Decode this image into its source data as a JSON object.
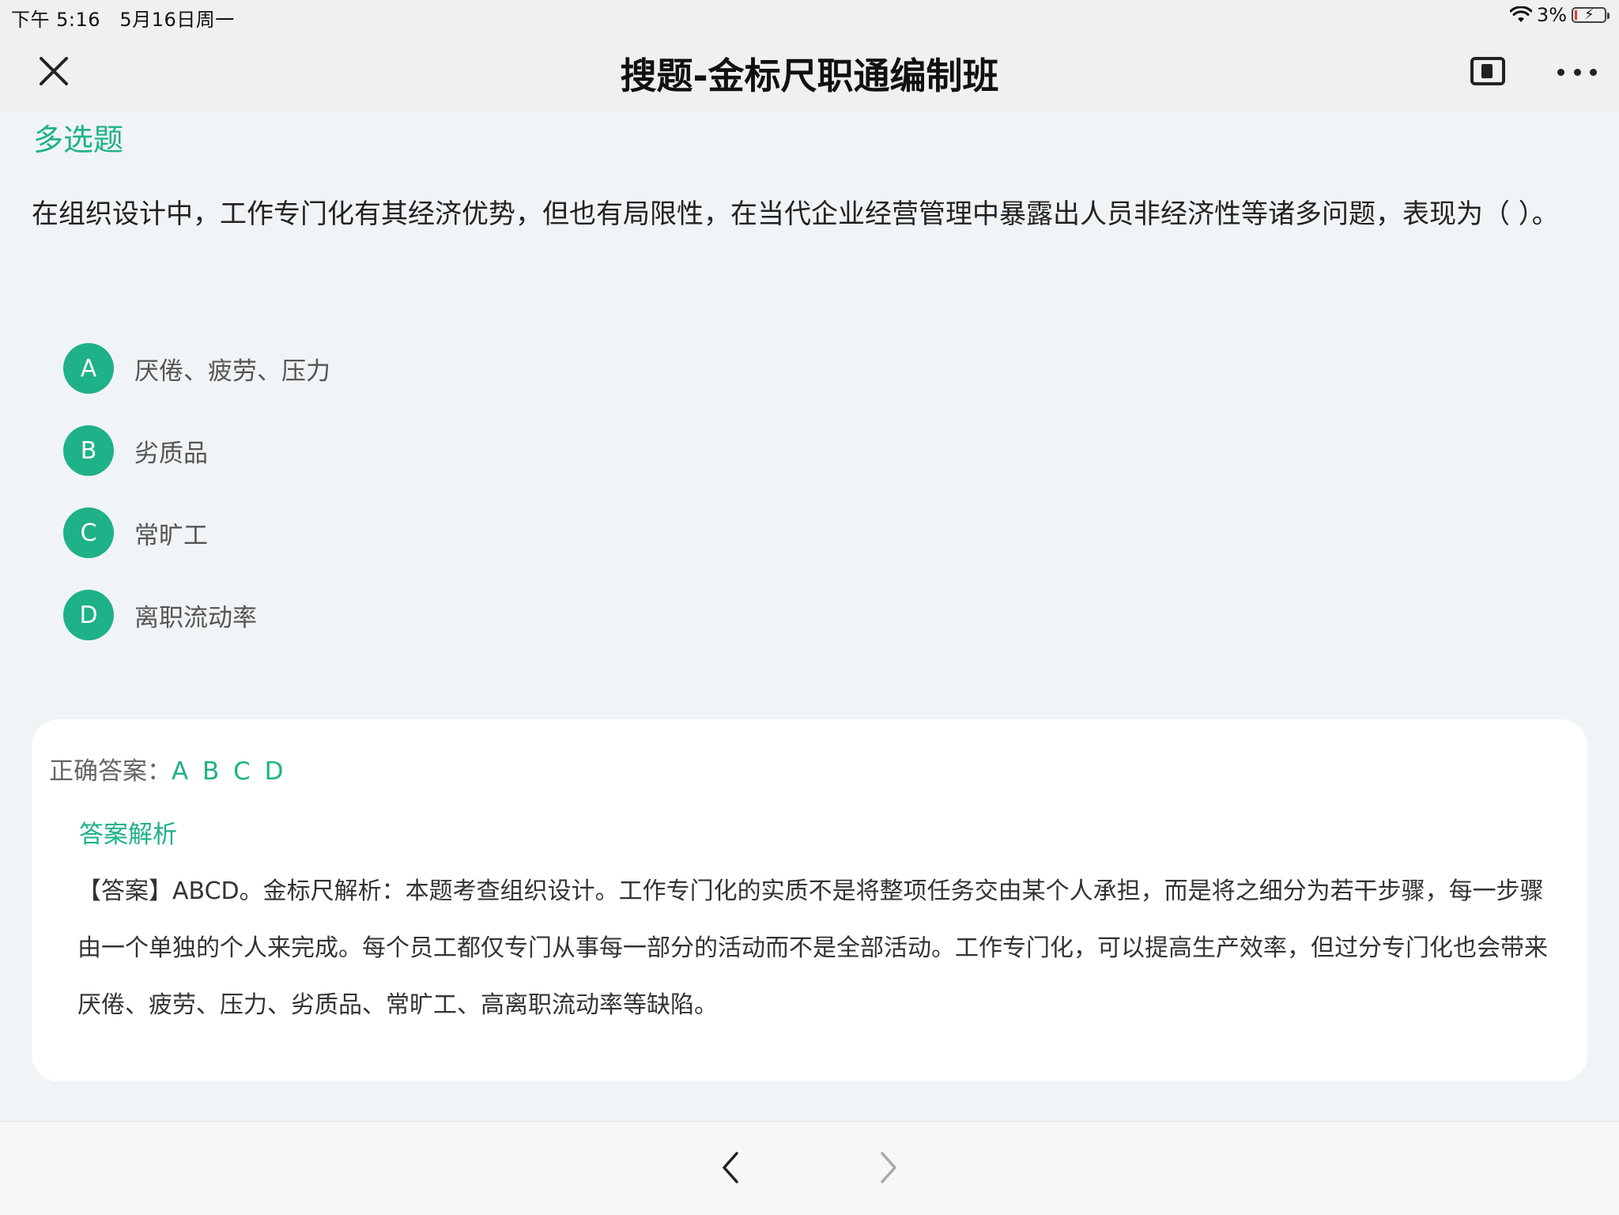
{
  "status_bar": {
    "time": "下午 5:16",
    "date": "5月16日周一",
    "battery": "3%"
  },
  "nav": {
    "title": "搜题-金标尺职通编制班"
  },
  "question": {
    "type": "多选题",
    "stem": "在组织设计中，工作专门化有其经济优势，但也有局限性，在当代企业经营管理中暴露出人员非经济性等诸多问题，表现为（ ）。",
    "options": [
      {
        "letter": "A",
        "text": "厌倦、疲劳、压力"
      },
      {
        "letter": "B",
        "text": "劣质品"
      },
      {
        "letter": "C",
        "text": "常旷工"
      },
      {
        "letter": "D",
        "text": "离职流动率"
      }
    ]
  },
  "answer": {
    "label": "正确答案：",
    "value": "A B C D",
    "analysis_title": "答案解析",
    "analysis_body": "【答案】ABCD。金标尺解析：本题考查组织设计。工作专门化的实质不是将整项任务交由某个人承担，而是将之细分为若干步骤，每一步骤由一个单独的个人来完成。每个员工都仅专门从事每一部分的活动而不是全部活动。工作专门化，可以提高生产效率，但过分专门化也会带来厌倦、疲劳、压力、劣质品、常旷工、高离职流动率等缺陷。"
  },
  "colors": {
    "accent": "#1fb187",
    "card": "#ffffff",
    "background": "#f0f4f7"
  }
}
